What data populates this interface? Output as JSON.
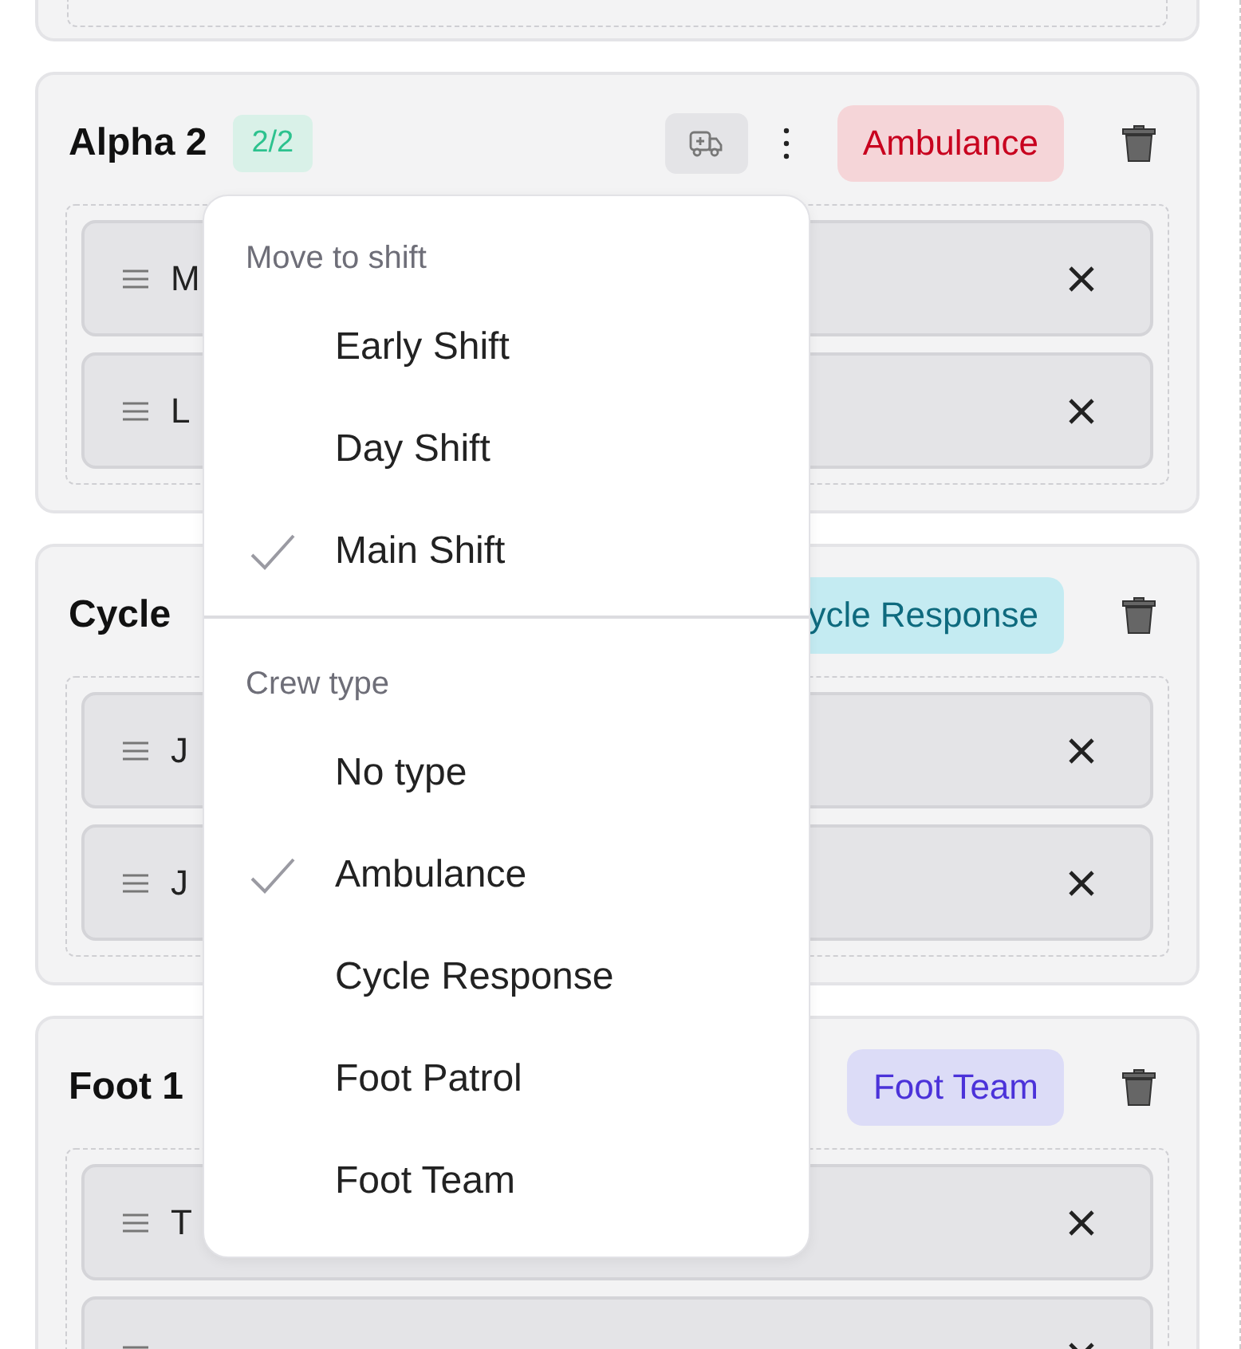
{
  "crews": [
    {
      "name": "Alpha 2",
      "count": "2/2",
      "show_tools": true,
      "tag": {
        "label": "Ambulance",
        "kind": "ambulance"
      },
      "members": [
        {
          "name": "M"
        },
        {
          "name": "L"
        }
      ]
    },
    {
      "name": "Cycle",
      "tag": {
        "label": "ycle Response",
        "kind": "cycle"
      },
      "members": [
        {
          "name": "J"
        },
        {
          "name": "J"
        }
      ]
    },
    {
      "name": "Foot 1",
      "tag": {
        "label": "Foot Team",
        "kind": "foot"
      },
      "members": [
        {
          "name": "T"
        }
      ],
      "cut_row_below": true
    }
  ],
  "menu": {
    "sections": [
      {
        "label": "Move to shift",
        "items": [
          {
            "label": "Early Shift",
            "selected": false
          },
          {
            "label": "Day Shift",
            "selected": false
          },
          {
            "label": "Main Shift",
            "selected": true
          }
        ]
      },
      {
        "label": "Crew type",
        "items": [
          {
            "label": "No type",
            "selected": false
          },
          {
            "label": "Ambulance",
            "selected": true
          },
          {
            "label": "Cycle Response",
            "selected": false
          },
          {
            "label": "Foot Patrol",
            "selected": false
          },
          {
            "label": "Foot Team",
            "selected": false
          }
        ]
      }
    ]
  }
}
